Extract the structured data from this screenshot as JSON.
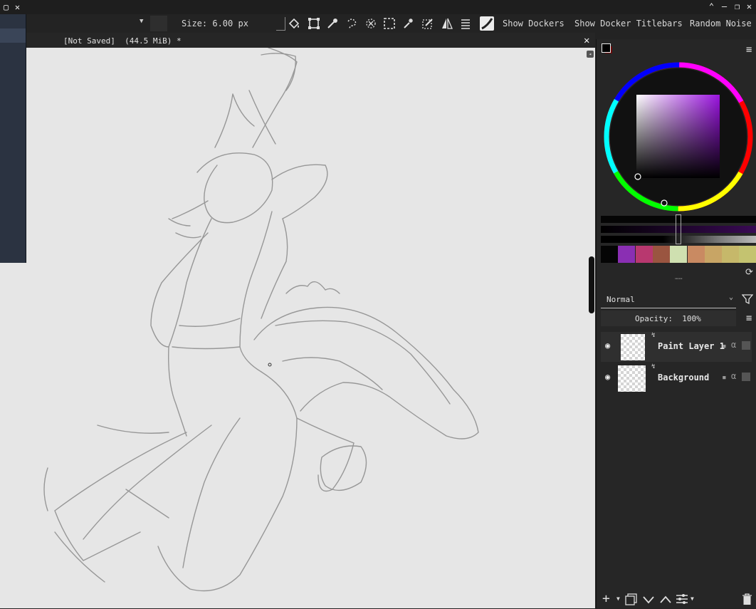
{
  "toolbar": {
    "size_label": "Size: 6.00 px",
    "show_dockers": "Show Dockers",
    "show_docker_titlebars": "Show Docker Titlebars",
    "random_noise": "Random Noise"
  },
  "document": {
    "title": "[Not Saved]  (44.5 MiB) *"
  },
  "color": {
    "foreground": "#000000",
    "background": "#6a0a0a",
    "hue": "#9b14e0",
    "palette": [
      "#050505",
      "#8a2fb3",
      "#b8386f",
      "#9a5540",
      "#cfe0b0",
      "#c98a62",
      "#c8a565",
      "#c6b86a",
      "#c4c370"
    ]
  },
  "layers": {
    "blend_mode": "Normal",
    "opacity_label": "Opacity:  100%",
    "items": [
      {
        "name": "Paint Layer 1",
        "selected": true
      },
      {
        "name": "Background",
        "selected": false
      }
    ]
  },
  "icons": {
    "close": "✕",
    "maximize": "□",
    "minimize": "—",
    "restore": "⧉",
    "up": "^",
    "menu": "≡",
    "eye": "👁",
    "add": "+",
    "duplicate": "⧉",
    "down": "⌄",
    "up_chev": "⌃",
    "properties": "☰",
    "delete": "🗑"
  }
}
